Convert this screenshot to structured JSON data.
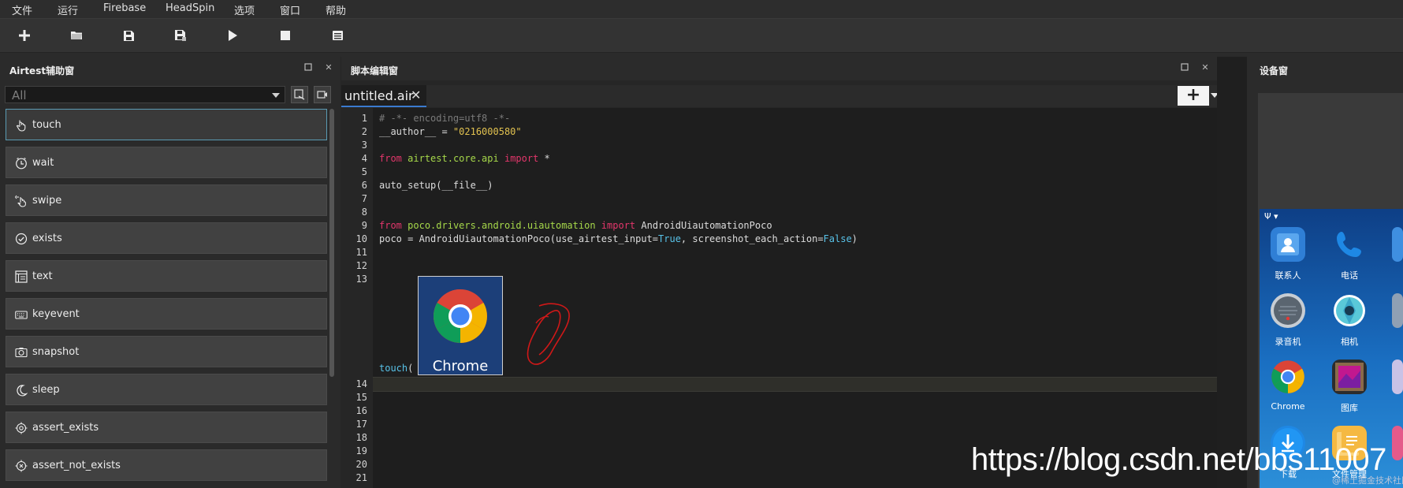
{
  "menubar": {
    "items": [
      "文件",
      "运行",
      "Firebase",
      "HeadSpin",
      "选项",
      "窗口",
      "帮助"
    ]
  },
  "toolbar": {
    "buttons": [
      "new-file-icon",
      "open-folder-icon",
      "save-icon",
      "save-as-icon",
      "run-icon",
      "stop-icon",
      "log-icon"
    ]
  },
  "assistant_panel": {
    "title": "Airtest辅助窗",
    "filter_value": "All",
    "api_buttons": [
      {
        "label": "touch",
        "icon": "hand-pointer-icon"
      },
      {
        "label": "wait",
        "icon": "clock-icon"
      },
      {
        "label": "swipe",
        "icon": "hand-swipe-icon"
      },
      {
        "label": "exists",
        "icon": "check-circle-icon"
      },
      {
        "label": "text",
        "icon": "text-box-icon"
      },
      {
        "label": "keyevent",
        "icon": "keyboard-icon"
      },
      {
        "label": "snapshot",
        "icon": "camera-icon"
      },
      {
        "label": "sleep",
        "icon": "moon-icon"
      },
      {
        "label": "assert_exists",
        "icon": "target-icon"
      },
      {
        "label": "assert_not_exists",
        "icon": "target-x-icon"
      }
    ]
  },
  "editor_panel": {
    "title": "脚本编辑窗",
    "tab_name": "untitled.air",
    "close_glyph": "✕",
    "new_tab_glyph": "+",
    "line_numbers": [
      "1",
      "2",
      "3",
      "4",
      "5",
      "6",
      "7",
      "8",
      "9",
      "10",
      "11",
      "12",
      "13",
      "14",
      "15",
      "16",
      "17",
      "18",
      "19",
      "20",
      "21"
    ],
    "code": {
      "line1": "# -*- encoding=utf8 -*-",
      "line2_var": "__author__ = ",
      "line2_str": "\"0216000580\"",
      "line4_from": "from",
      "line4_mod": "airtest.core.api",
      "line4_import": "import",
      "line4_rest": " *",
      "line6": "auto_setup(__file__)",
      "line9_from": "from",
      "line9_mod": "poco.drivers.android.uiautomation",
      "line9_import": "import",
      "line9_rest": " AndroidUiautomationPoco",
      "line10_a": "poco = AndroidUiautomationPoco(use_airtest_input=",
      "line10_true": "True",
      "line10_b": ", screenshot_each_action=",
      "line10_false": "False",
      "line10_c": ")",
      "line13_fn": "touch",
      "line13_open": "(",
      "line13_close": ")"
    },
    "image_thumbnail_caption": "Chrome"
  },
  "device_panel": {
    "title": "设备窗",
    "apps": [
      {
        "label": "联系人",
        "color": "#2f7fd6"
      },
      {
        "label": "电话",
        "color": "#1e88e5"
      },
      {
        "label": "录音机",
        "color": "#c7cdd3"
      },
      {
        "label": "相机",
        "color": "#5ac8d8"
      },
      {
        "label": "Chrome",
        "color": "#ffffff"
      },
      {
        "label": "图库",
        "color": "#8e44ad"
      },
      {
        "label": "下载",
        "color": "#1e88e5"
      },
      {
        "label": "文件管理",
        "color": "#f5b942"
      }
    ]
  },
  "watermark": {
    "text": "https://blog.csdn.net/bbs11007",
    "sub": "@稀土掘金技术社区"
  },
  "colors": {
    "keyword": "#e3366b",
    "string": "#e2c250",
    "module": "#a6d84a",
    "builtin": "#58c2e8",
    "active_border": "#5a9bb3",
    "tab_accent": "#3b7bd0"
  }
}
